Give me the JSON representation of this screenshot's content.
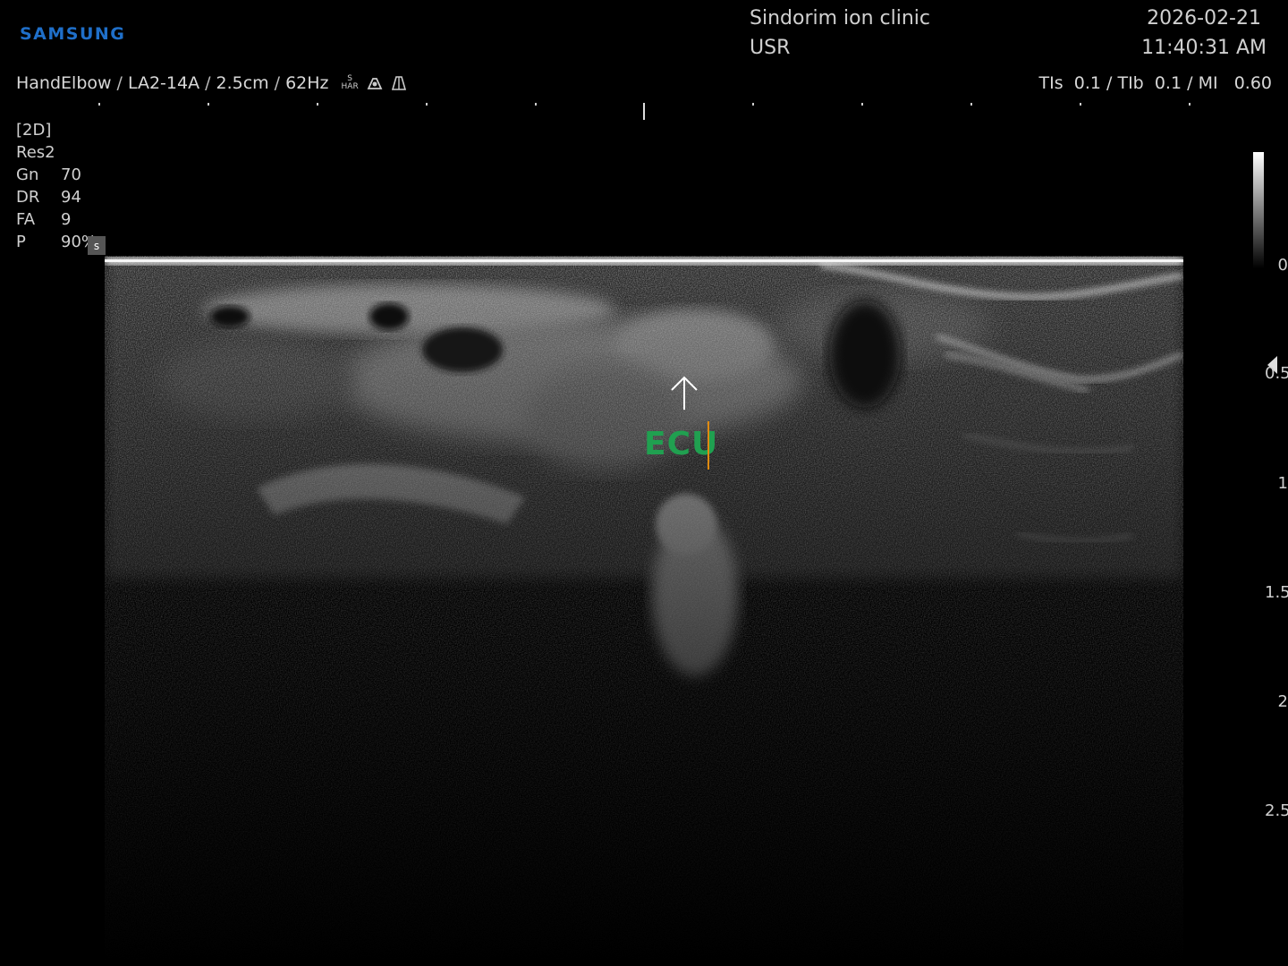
{
  "header": {
    "brand": "SAMSUNG",
    "clinic": "Sindorim ion clinic",
    "user": "USR",
    "date": "2026-02-21",
    "time": "11:40:31 AM"
  },
  "probe": {
    "preset": "HandElbow",
    "transducer": "LA2-14A",
    "depth": "2.5cm",
    "frame_rate": "62Hz",
    "icons": [
      "s-har-icon",
      "probe-icon",
      "beam-icon"
    ],
    "har_top": "S",
    "har_bottom": "HAR"
  },
  "safety": {
    "tis_label": "TIs",
    "tis": "0.1",
    "tib_label": "TIb",
    "tib": "0.1",
    "mi_label": "MI",
    "mi": "0.60"
  },
  "params": {
    "mode": "[2D]",
    "preset": "Res2",
    "gain_label": "Gn",
    "gain": "70",
    "dr_label": "DR",
    "dr": "94",
    "fa_label": "FA",
    "fa": "9",
    "power_label": "P",
    "power": "90%",
    "power_icon": "s"
  },
  "annotation": {
    "text": "ECU",
    "text_color": "#20a050",
    "cursor_color": "#e08a10"
  },
  "depth_scale": [
    "0",
    "0.5",
    "1",
    "1.5",
    "2",
    "2.5"
  ],
  "colors": {
    "brand": "#1f6fc9",
    "background": "#000000"
  }
}
